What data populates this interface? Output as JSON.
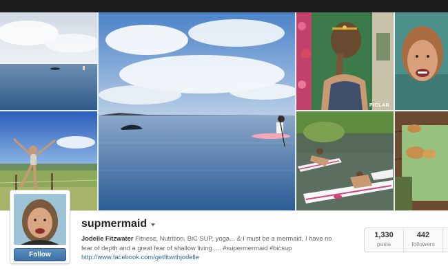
{
  "profile": {
    "username": "supmermaid",
    "full_name": "Jodelle Fitzwater",
    "bio_line1": "Fitness, Nutrition, BiC SUP, yoga... & I must be a mermaid, I have no",
    "bio_line2": "fear of depth and a great fear of shallow living. ... #supermermaid #bicsup",
    "website": "http://www.facebook.com/getfitwithjodelle",
    "follow_label": "Follow"
  },
  "stats": [
    {
      "value": "1,330",
      "label": "posts"
    },
    {
      "value": "442",
      "label": "followers"
    }
  ],
  "photos": {
    "watermark": "PICLAB"
  },
  "icons": {
    "username_menu": "chevron-down-icon"
  }
}
